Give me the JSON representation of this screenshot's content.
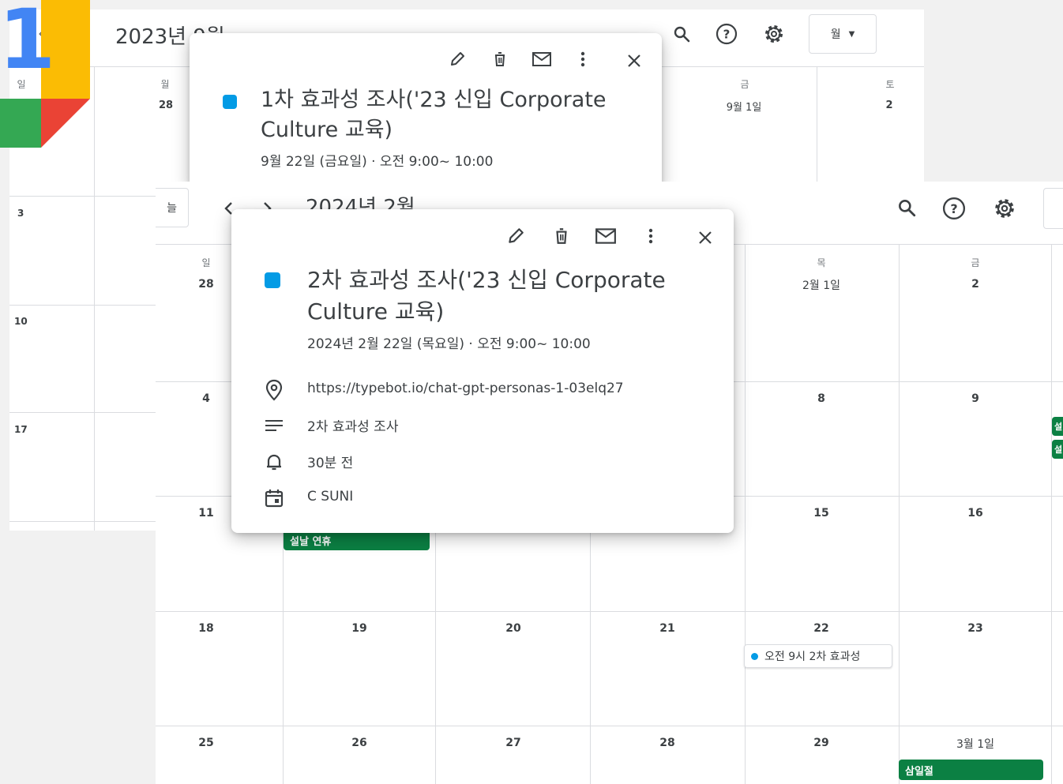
{
  "back_window": {
    "title": "2023년 9월",
    "view_label": "월",
    "dow_sun": "일",
    "dow_mon": "월",
    "dow_fri": "금",
    "dow_sat": "토",
    "day_28": "28",
    "day_sep1": "9월 1일",
    "day_2": "2",
    "week_3": "3",
    "week_10": "10",
    "week_17": "17"
  },
  "back_popup": {
    "title": "1차 효과성 조사('23 신입 Corporate Culture 교육)",
    "time": "9월 22일 (금요일) · 오전 9:00~ 10:00"
  },
  "front_window": {
    "title": "2024년 2월",
    "today_label": "늘",
    "dow_sun": "일",
    "dow_thu": "목",
    "dow_fri": "금",
    "header_days": {
      "d28": "28",
      "feb1": "2월 1일",
      "d2": "2"
    },
    "rows": [
      [
        "4",
        "",
        "",
        "",
        "8",
        "9"
      ],
      [
        "11",
        "",
        "",
        "",
        "15",
        "16"
      ],
      [
        "18",
        "19",
        "20",
        "21",
        "22",
        "23"
      ],
      [
        "25",
        "26",
        "27",
        "28",
        "29",
        "3월 1일"
      ]
    ],
    "holiday_seollal": "설날 연휴",
    "holiday_samiljeol": "삼일절",
    "event_chip": "오전 9시 2차 효과성",
    "edge_badges": [
      "설",
      "설"
    ]
  },
  "front_popup": {
    "title": "2차 효과성 조사('23 신입 Corporate Culture 교육)",
    "time": "2024년 2월 22일 (목요일) · 오전 9:00~ 10:00",
    "location": "https://typebot.io/chat-gpt-personas-1-03elq27",
    "description": "2차 효과성 조사",
    "reminder": "30분 전",
    "calendar": "C SUNI"
  },
  "logo_text": "1",
  "colors": {
    "accent_blue": "#039be5",
    "holiday_green": "#0b8043",
    "logo_blue": "#4285f4",
    "logo_yellow": "#fbbc04",
    "logo_green": "#34a853",
    "logo_red": "#ea4335"
  },
  "icons": [
    "search-icon",
    "help-icon",
    "settings-icon",
    "edit-icon",
    "delete-icon",
    "email-icon",
    "more-icon",
    "close-icon",
    "location-icon",
    "description-icon",
    "bell-icon",
    "calendar-icon",
    "chevron-left-icon",
    "chevron-right-icon",
    "dropdown-icon"
  ]
}
